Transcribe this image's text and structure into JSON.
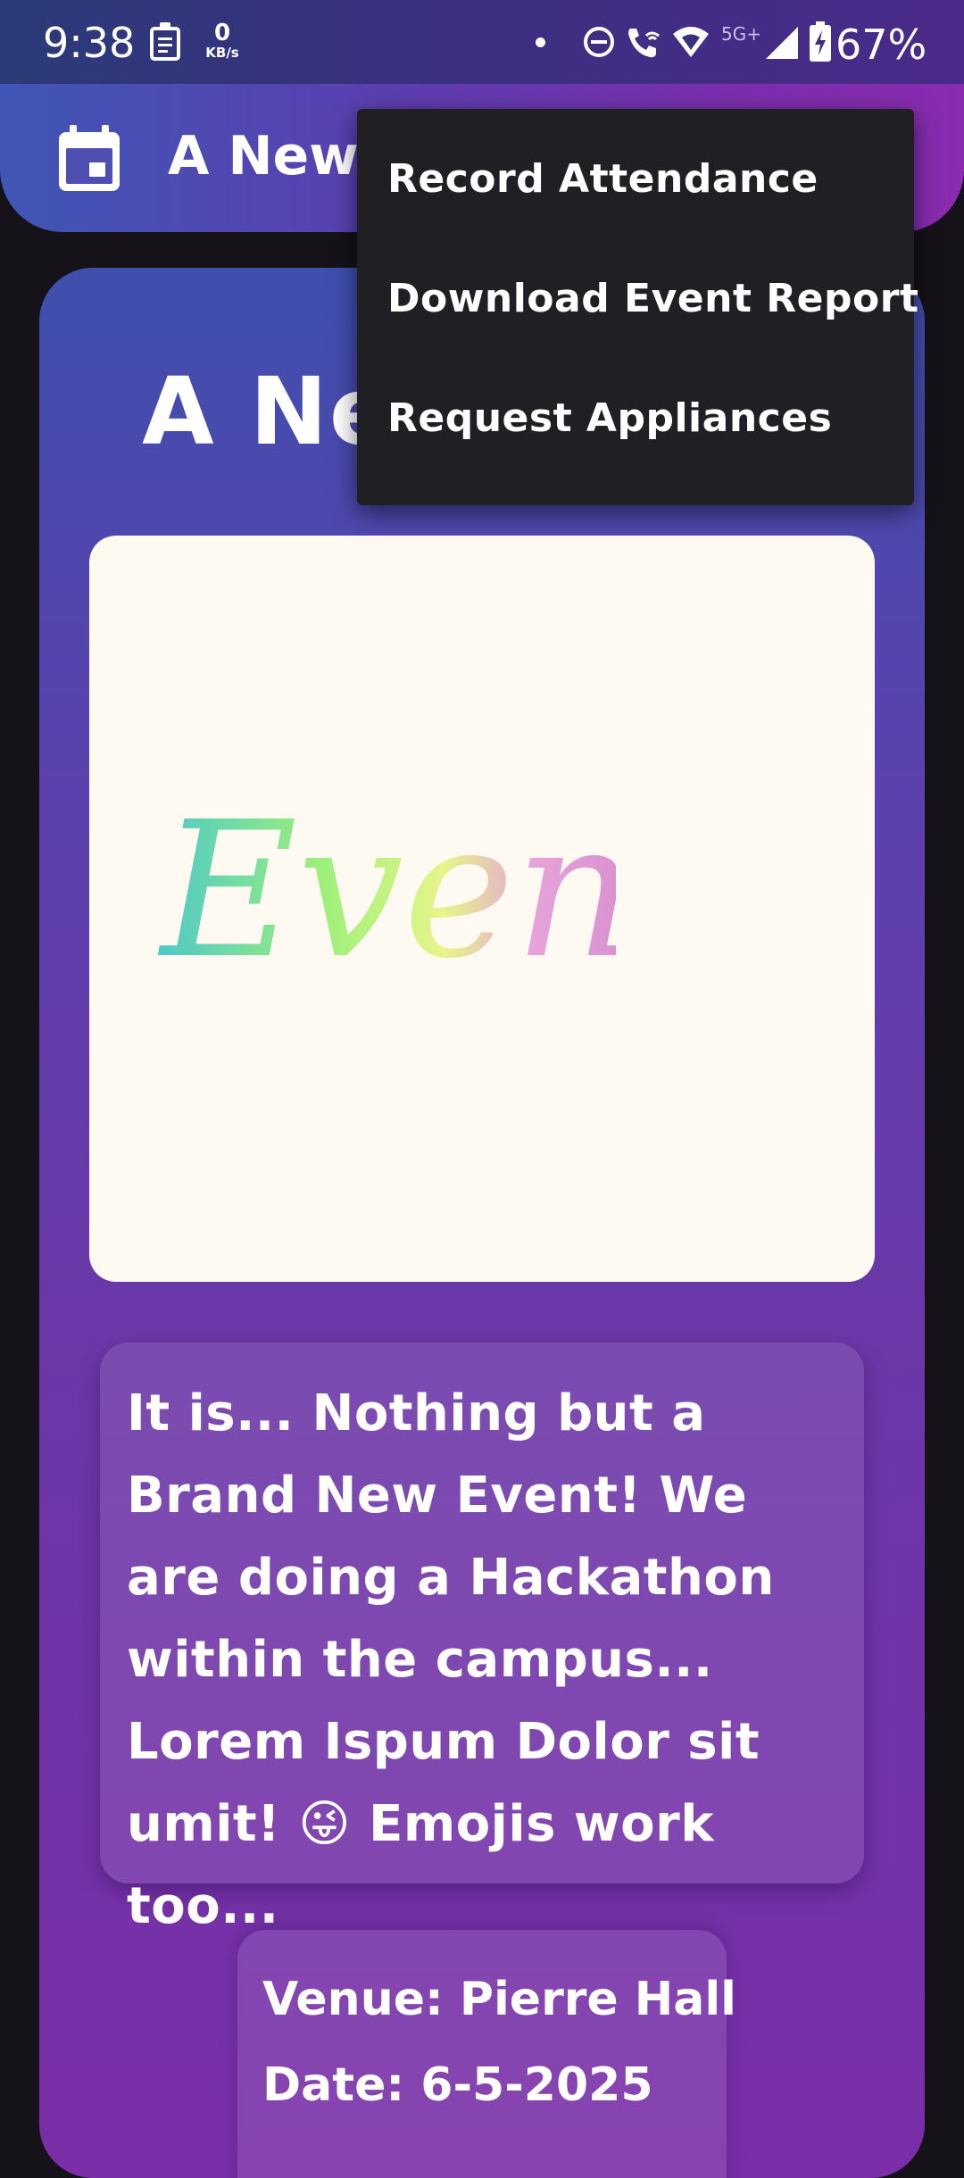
{
  "status_bar": {
    "time": "9:38",
    "net_speed_value": "0",
    "net_speed_unit": "KB/s",
    "network_type": "5G+",
    "battery": "67%",
    "icons": [
      "clipboard-icon",
      "dot-icon",
      "dnd-icon",
      "wifi-calling-icon",
      "wifi-icon",
      "signal-icon",
      "battery-charging-icon"
    ]
  },
  "app_bar": {
    "title": "A New",
    "icon": "calendar-icon",
    "gradient": [
      "#3f56b5",
      "#8a2bb0"
    ]
  },
  "menu": {
    "items": [
      {
        "label": "Record Attendance"
      },
      {
        "label": "Download Event Report"
      },
      {
        "label": "Request Appliances"
      }
    ]
  },
  "event": {
    "heading": "A New Event",
    "image_text": "Even",
    "description": "It is...  Nothing but a Brand New Event! We are doing a Hackathon within the campus... Lorem Ispum Dolor sit umit! 😜 Emojis work too...",
    "venue": "Venue: Pierre Hall",
    "date": "Date: 6-5-2025"
  },
  "colors": {
    "card_gradient_top": "#3f4fae",
    "card_gradient_bottom": "#7a2ea8",
    "menu_background": "#201f24",
    "image_background": "#fef9f1"
  }
}
